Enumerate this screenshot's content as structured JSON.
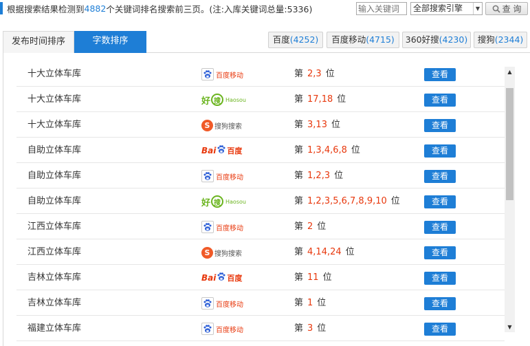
{
  "header": {
    "prefix": "根据搜索结果检测到",
    "count": "4882",
    "suffix": "个关键词排名搜索前三页。(注:入库关键词总量:5336)"
  },
  "search": {
    "placeholder": "输入关键词"
  },
  "engine_select": {
    "selected": "全部搜索引擎"
  },
  "query_button": {
    "label": "查 询"
  },
  "sort_tabs": [
    {
      "label": "发布时间排序",
      "active": false
    },
    {
      "label": "字数排序",
      "active": true
    }
  ],
  "engine_tabs": [
    {
      "name": "百度",
      "count": "(4252)"
    },
    {
      "name": "百度移动",
      "count": "(4715)"
    },
    {
      "name": "360好搜",
      "count": "(4230)"
    },
    {
      "name": "搜狗",
      "count": "(2344)"
    }
  ],
  "rank_prefix": "第",
  "rank_suffix": "位",
  "rows": [
    {
      "keyword": "十大立体车库",
      "engine": "baidu-mobile",
      "positions": "2,3",
      "action": "查看"
    },
    {
      "keyword": "十大立体车库",
      "engine": "haosou",
      "positions": "17,18",
      "action": "查看"
    },
    {
      "keyword": "十大立体车库",
      "engine": "sogou",
      "positions": "3,13",
      "action": "查看"
    },
    {
      "keyword": "自助立体车库",
      "engine": "baidu",
      "positions": "1,3,4,6,8",
      "action": "查看"
    },
    {
      "keyword": "自助立体车库",
      "engine": "baidu-mobile",
      "positions": "1,2,3",
      "action": "查看"
    },
    {
      "keyword": "自助立体车库",
      "engine": "haosou",
      "positions": "1,2,3,5,6,7,8,9,10",
      "action": "查看"
    },
    {
      "keyword": "江西立体车库",
      "engine": "baidu-mobile",
      "positions": "2",
      "action": "查看"
    },
    {
      "keyword": "江西立体车库",
      "engine": "sogou",
      "positions": "4,14,24",
      "action": "查看"
    },
    {
      "keyword": "吉林立体车库",
      "engine": "baidu",
      "positions": "11",
      "action": "查看"
    },
    {
      "keyword": "吉林立体车库",
      "engine": "baidu-mobile",
      "positions": "1",
      "action": "查看"
    },
    {
      "keyword": "福建立体车库",
      "engine": "baidu-mobile",
      "positions": "3",
      "action": "查看"
    }
  ],
  "logos": {
    "baidu-mobile": {
      "text": "百度移动"
    },
    "haosou": {
      "hao": "好",
      "sou": "搜",
      "en": "Haosou"
    },
    "sogou": {
      "s": "S",
      "text": "搜狗搜索"
    },
    "baidu": {
      "bai": "Bai",
      "text": "百度"
    }
  },
  "colors": {
    "accent": "#1e7ed6",
    "rank": "#e8380d"
  }
}
